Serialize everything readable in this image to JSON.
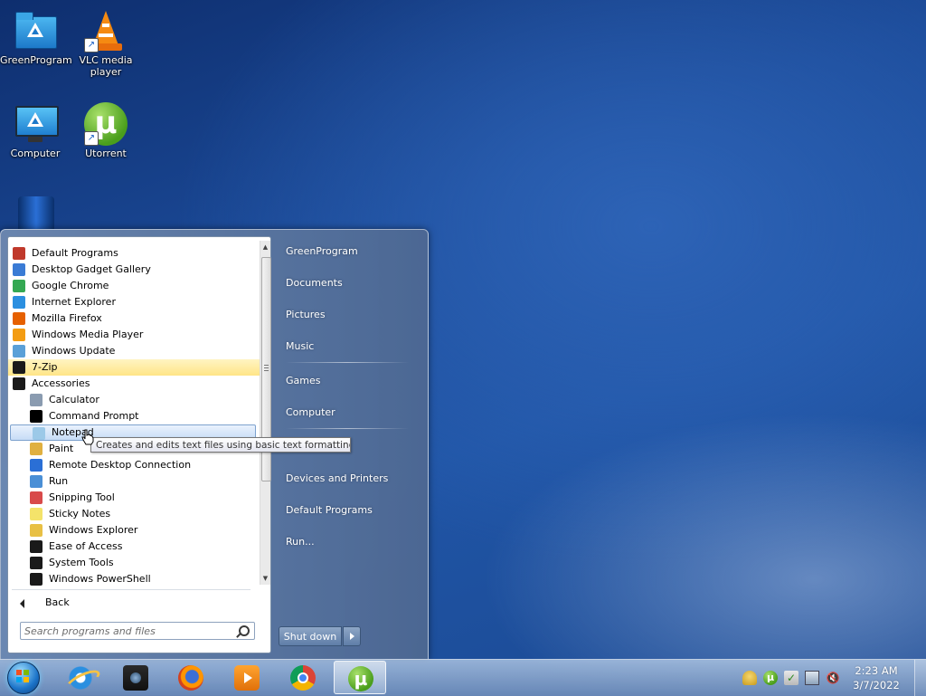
{
  "desktop": {
    "icons": [
      {
        "label": "GreenProgram",
        "icon": "folder-icon"
      },
      {
        "label": "VLC media player",
        "icon": "vlc-icon"
      },
      {
        "label": "Computer",
        "icon": "monitor-icon"
      },
      {
        "label": "Utorrent",
        "icon": "utorrent-icon"
      }
    ]
  },
  "start_menu": {
    "programs": [
      {
        "label": "Default Programs",
        "icon": "default-programs-icon",
        "color": "#c0392b"
      },
      {
        "label": "Desktop Gadget Gallery",
        "icon": "gadget-gallery-icon",
        "color": "#3a7bd5"
      },
      {
        "label": "Google Chrome",
        "icon": "chrome-icon",
        "color": "#34a853"
      },
      {
        "label": "Internet Explorer",
        "icon": "ie-icon",
        "color": "#2b8fe0"
      },
      {
        "label": "Mozilla Firefox",
        "icon": "firefox-icon",
        "color": "#e66000"
      },
      {
        "label": "Windows Media Player",
        "icon": "wmp-icon",
        "color": "#f39c12"
      },
      {
        "label": "Windows Update",
        "icon": "windows-update-icon",
        "color": "#5aa0d8"
      },
      {
        "label": "7-Zip",
        "icon": "folder-icon",
        "color": "#1a1a1a",
        "highlighted": true
      },
      {
        "label": "Accessories",
        "icon": "folder-icon",
        "color": "#1a1a1a"
      },
      {
        "label": "Calculator",
        "icon": "calculator-icon",
        "color": "#8a9bb0",
        "sub": true
      },
      {
        "label": "Command Prompt",
        "icon": "cmd-icon",
        "color": "#000000",
        "sub": true
      },
      {
        "label": "Notepad",
        "icon": "notepad-icon",
        "color": "#9cc9e8",
        "sub": true,
        "selected": true
      },
      {
        "label": "Paint",
        "icon": "paint-icon",
        "color": "#e0b040",
        "sub": true
      },
      {
        "label": "Remote Desktop Connection",
        "icon": "remote-desktop-icon",
        "color": "#2a6fd6",
        "sub": true
      },
      {
        "label": "Run",
        "icon": "run-icon",
        "color": "#4a8fd6",
        "sub": true
      },
      {
        "label": "Snipping Tool",
        "icon": "snipping-tool-icon",
        "color": "#d84a4a",
        "sub": true
      },
      {
        "label": "Sticky Notes",
        "icon": "sticky-notes-icon",
        "color": "#f4e36a",
        "sub": true
      },
      {
        "label": "Windows Explorer",
        "icon": "explorer-icon",
        "color": "#e8c044",
        "sub": true
      },
      {
        "label": "Ease of Access",
        "icon": "folder-icon",
        "color": "#1a1a1a",
        "sub": true
      },
      {
        "label": "System Tools",
        "icon": "folder-icon",
        "color": "#1a1a1a",
        "sub": true
      },
      {
        "label": "Windows PowerShell",
        "icon": "folder-icon",
        "color": "#1a1a1a",
        "sub": true
      }
    ],
    "back_label": "Back",
    "search_placeholder": "Search programs and files",
    "tooltip": "Creates and edits text files using basic text formatting.",
    "right_items": [
      {
        "label": "GreenProgram",
        "name": "right-item-greenprogram"
      },
      {
        "label": "Documents",
        "name": "right-item-documents"
      },
      {
        "label": "Pictures",
        "name": "right-item-pictures"
      },
      {
        "label": "Music",
        "name": "right-item-music"
      },
      {
        "label": "Games",
        "name": "right-item-games"
      },
      {
        "label": "Computer",
        "name": "right-item-computer"
      },
      {
        "label": "Devices and Printers",
        "name": "right-item-devices-printers"
      },
      {
        "label": "Default Programs",
        "name": "right-item-default-programs"
      },
      {
        "label": "Run...",
        "name": "right-item-run"
      }
    ],
    "shutdown_label": "Shut down"
  },
  "taskbar": {
    "pinned": [
      {
        "icon": "ie-icon",
        "name": "taskbar-internet-explorer"
      },
      {
        "icon": "cam-icon",
        "name": "taskbar-webcam-app"
      },
      {
        "icon": "firefox-icon",
        "name": "taskbar-firefox"
      },
      {
        "icon": "wmp-icon",
        "name": "taskbar-media-player"
      },
      {
        "icon": "chrome-icon",
        "name": "taskbar-chrome"
      },
      {
        "icon": "ut-icon",
        "name": "taskbar-utorrent",
        "active": true
      }
    ],
    "tray_icons": [
      "notification-icon",
      "utorrent-tray-icon",
      "action-center-icon",
      "network-icon",
      "volume-muted-icon"
    ],
    "clock_time": "2:23 AM",
    "clock_date": "3/7/2022"
  }
}
